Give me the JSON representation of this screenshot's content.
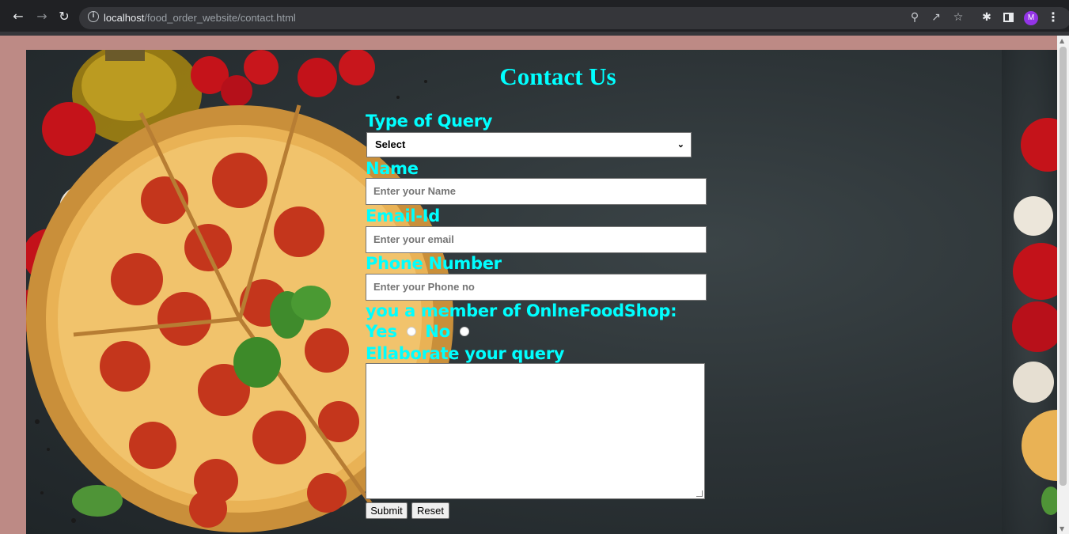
{
  "browser": {
    "url_host": "localhost",
    "url_path": "/food_order_website/contact.html",
    "avatar_initial": "M",
    "icons": [
      "back-arrow-icon",
      "forward-arrow-icon",
      "reload-icon",
      "info-icon",
      "zoom-icon",
      "share-icon",
      "star-icon",
      "extensions-icon",
      "side-panel-icon",
      "menu-icon"
    ]
  },
  "form": {
    "title": "Contact Us",
    "type_label": "Type of Query",
    "type_selected": "Select",
    "name_label": "Name",
    "name_placeholder": "Enter your Name",
    "email_label": "Email-Id",
    "email_placeholder": "Enter your email",
    "phone_label": "Phone Number",
    "phone_placeholder": "Enter your Phone no",
    "member_label": "you a member of OnlneFoodShop:",
    "yes_label": "Yes",
    "no_label": "No",
    "elaborate_label": "Ellaborate your query",
    "submit_label": "Submit",
    "reset_label": "Reset"
  },
  "colors": {
    "label": "#00ffff",
    "page_background": "#bd8a85",
    "chrome": "#202124"
  }
}
